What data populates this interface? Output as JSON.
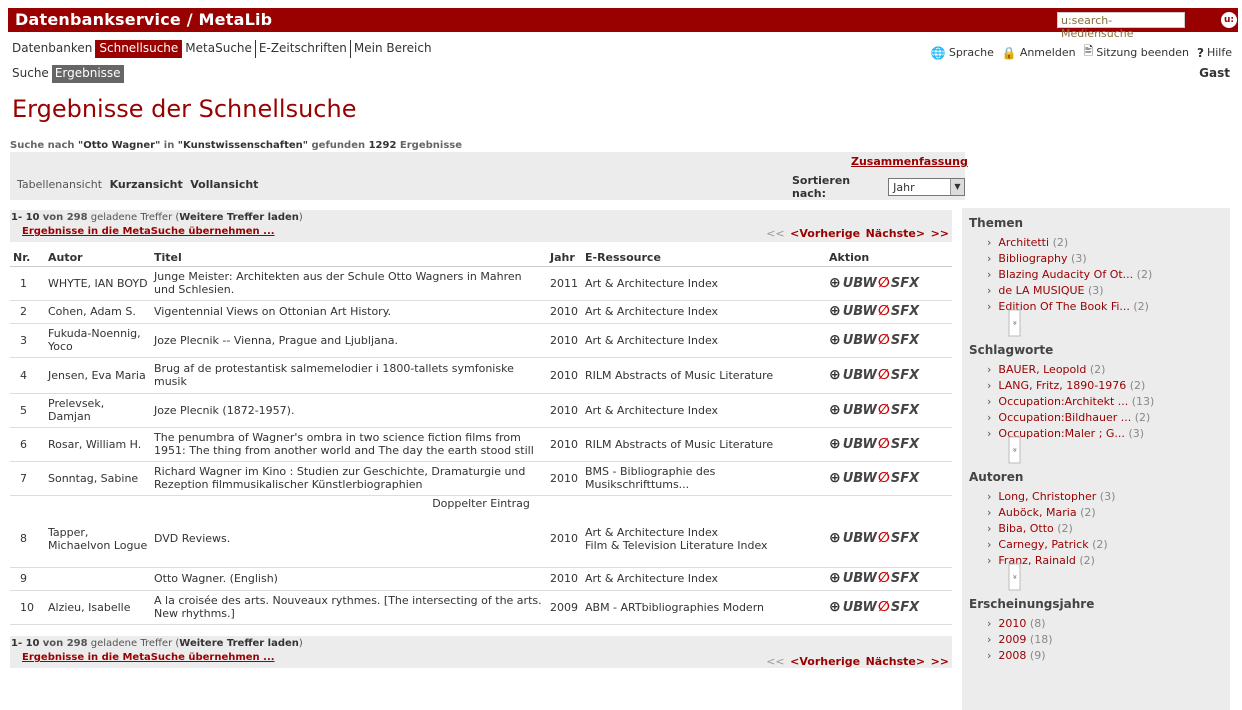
{
  "header": {
    "brand": "Datenbankservice / MetaLib",
    "search_value": "u:search-Mediensuche",
    "go_label": "u:"
  },
  "main_nav": [
    "Datenbanken",
    "Schnellsuche",
    "MetaSuche",
    "E-Zeitschriften",
    "Mein Bereich"
  ],
  "sub_nav": [
    "Suche",
    "Ergebnisse"
  ],
  "top_links": {
    "sprache": "Sprache",
    "anmelden": "Anmelden",
    "sitzung": "Sitzung beenden",
    "hilfe": "Hilfe",
    "user": "Gast"
  },
  "page_title": "Ergebnisse der Schnellsuche",
  "search_info": {
    "prefix": "Suche nach",
    "query": "\"Otto Wagner\"",
    "in": "in",
    "collection": "\"Kunstwissenschaften\"",
    "found": "gefunden",
    "count": "1292",
    "suffix": "Ergebnisse"
  },
  "options": {
    "summary_link": "Zusammenfassung",
    "views_label": "Tabellenansicht",
    "view_short": "Kurzansicht",
    "view_full": "Vollansicht",
    "sort_label": "Sortieren nach:",
    "sort_value": "Jahr"
  },
  "results_bar": {
    "range": "1- 10",
    "of": "von 298",
    "loaded": "geladene Treffer (",
    "load_more": "Weitere Treffer laden",
    "close_paren": ")",
    "metasuche": "Ergebnisse in die MetaSuche übernehmen ...",
    "first": "<<",
    "prev": "<Vorherige",
    "next": "Nächste>",
    "last": ">>"
  },
  "table_headers": {
    "nr": "Nr.",
    "author": "Autor",
    "title": "Titel",
    "year": "Jahr",
    "resource": "E-Ressource",
    "action": "Aktion"
  },
  "results": [
    {
      "nr": "1",
      "author": "WHYTE, IAN BOYD",
      "title": "Junge Meister: Architekten aus der Schule Otto Wagners in Mahren und Schlesien.",
      "year": "2011",
      "resource": "Art & Architecture Index"
    },
    {
      "nr": "2",
      "author": "Cohen, Adam S.",
      "title": "Vigentennial Views on Ottonian Art History.",
      "year": "2010",
      "resource": "Art & Architecture Index"
    },
    {
      "nr": "3",
      "author": "Fukuda-Noennig, Yoco",
      "title": "Joze Plecnik -- Vienna, Prague and Ljubljana.",
      "year": "2010",
      "resource": "Art & Architecture Index"
    },
    {
      "nr": "4",
      "author": "Jensen, Eva Maria",
      "title": "Brug af de protestantisk salmemelodier i 1800-tallets symfoniske musik",
      "year": "2010",
      "resource": "RILM Abstracts of Music Literature"
    },
    {
      "nr": "5",
      "author": "Prelevsek, Damjan",
      "title": "Joze Plecnik (1872-1957).",
      "year": "2010",
      "resource": "Art & Architecture Index"
    },
    {
      "nr": "6",
      "author": "Rosar, William H.",
      "title": "The penumbra of Wagner's ombra in two science fiction films from 1951: The thing from another world and The day the earth stood still",
      "year": "2010",
      "resource": "RILM Abstracts of Music Literature"
    },
    {
      "nr": "7",
      "author": "Sonntag, Sabine",
      "title": "Richard Wagner im Kino : Studien zur Geschichte, Dramaturgie und Rezeption filmmusikalischer Künstlerbiographien",
      "year": "2010",
      "resource": "BMS - Bibliographie des Musikschrifttums..."
    },
    {
      "duplicate": "Doppelter Eintrag"
    },
    {
      "nr": "8",
      "author": "Tapper, Michaelvon Logue",
      "title": "DVD Reviews.",
      "year": "2010",
      "resource": "Art & Architecture Index",
      "resource2": "Film & Television Literature Index"
    },
    {
      "nr": "9",
      "author": "",
      "title": "Otto Wagner. (English)",
      "year": "2010",
      "resource": "Art & Architecture Index"
    },
    {
      "nr": "10",
      "author": "Alzieu, Isabelle",
      "title": "A la croisée des arts. Nouveaux rythmes. [The intersecting of the arts. New rhythms.]",
      "year": "2009",
      "resource": "ABM - ARTbibliographies Modern"
    }
  ],
  "action": {
    "plus": "+",
    "ubw": "UBW",
    "sfx": "SFX"
  },
  "facets": [
    {
      "title": "Themen",
      "items": [
        {
          "label": "Architetti",
          "count": "(2)"
        },
        {
          "label": "Bibliography",
          "count": "(3)"
        },
        {
          "label": "Blazing Audacity Of Ot...",
          "count": "(2)"
        },
        {
          "label": "de LA MUSIQUE",
          "count": "(3)"
        },
        {
          "label": "Edition Of The Book Fi...",
          "count": "(2)"
        }
      ]
    },
    {
      "title": "Schlagworte",
      "items": [
        {
          "label": "BAUER, Leopold",
          "count": "(2)"
        },
        {
          "label": "LANG, Fritz, 1890-1976",
          "count": "(2)"
        },
        {
          "label": "Occupation:Architekt ...",
          "count": "(13)"
        },
        {
          "label": "Occupation:Bildhauer ...",
          "count": "(2)"
        },
        {
          "label": "Occupation:Maler ; G...",
          "count": "(3)"
        }
      ]
    },
    {
      "title": "Autoren",
      "items": [
        {
          "label": "Long, Christopher",
          "count": "(3)"
        },
        {
          "label": "Auböck, Maria",
          "count": "(2)"
        },
        {
          "label": "Biba, Otto",
          "count": "(2)"
        },
        {
          "label": "Carnegy, Patrick",
          "count": "(2)"
        },
        {
          "label": "Franz, Rainald",
          "count": "(2)"
        }
      ]
    },
    {
      "title": "Erscheinungsjahre",
      "items": [
        {
          "label": "2010",
          "count": "(8)"
        },
        {
          "label": "2009",
          "count": "(18)"
        },
        {
          "label": "2008",
          "count": "(9)"
        }
      ]
    }
  ],
  "more_toggle": "»",
  "icons": {
    "globe": "globe-icon",
    "lock": "lock-icon",
    "logout": "logout-icon",
    "help": "help-icon"
  },
  "colors": {
    "brand": "#990000",
    "panel": "#ececec",
    "active_sub": "#666666"
  }
}
